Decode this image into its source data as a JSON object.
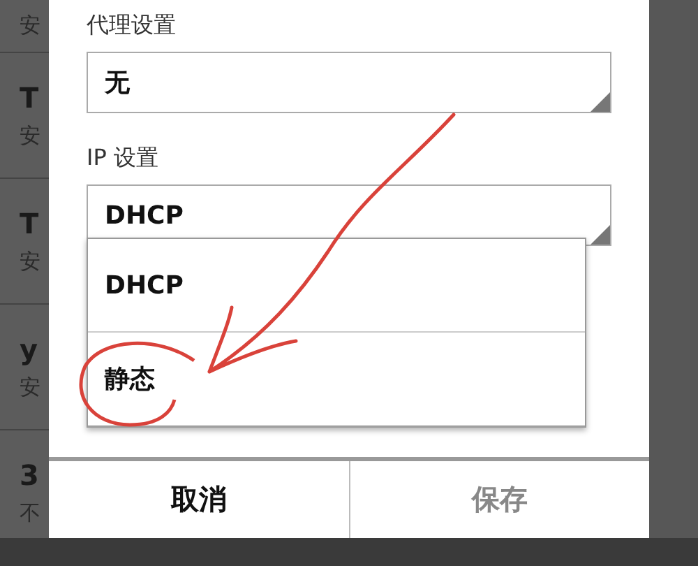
{
  "background_list": [
    {
      "subtitle": "安"
    },
    {
      "title": "T",
      "subtitle": "安"
    },
    {
      "title": "T",
      "subtitle": "安"
    },
    {
      "title": "y",
      "subtitle": "安"
    },
    {
      "title": "3",
      "subtitle": "不"
    }
  ],
  "dialog": {
    "fields": [
      {
        "label": "代理设置",
        "value": "无"
      },
      {
        "label": "IP 设置",
        "value": "DHCP"
      }
    ],
    "dropdown": {
      "options": [
        {
          "label": "DHCP",
          "circled": false
        },
        {
          "label": "静态",
          "circled": true
        }
      ]
    },
    "buttons": [
      {
        "label": "取消",
        "disabled": false
      },
      {
        "label": "保存",
        "disabled": true
      }
    ]
  },
  "annotation": {
    "kind": "arrow"
  }
}
